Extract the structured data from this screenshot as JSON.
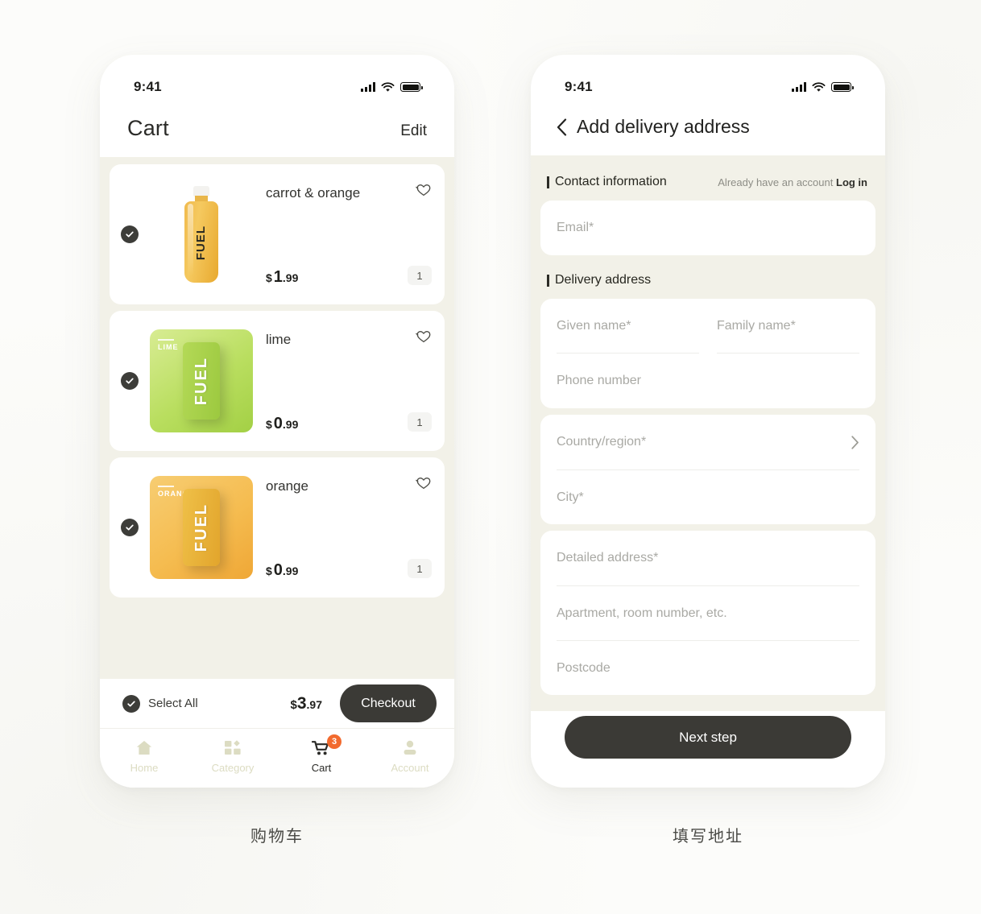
{
  "canvas": {
    "background": "#fcfcfa"
  },
  "phones": {
    "left_caption": "购物车",
    "right_caption": "填写地址"
  },
  "statusbar": {
    "time": "9:41",
    "signal_icon": "signal-bars-icon",
    "wifi_icon": "wifi-icon",
    "battery_icon": "battery-full-icon"
  },
  "cart_screen": {
    "title": "Cart",
    "edit_label": "Edit",
    "currency": "$",
    "items": [
      {
        "name": "carrot & orange",
        "price_whole": "1",
        "price_cents": ".99",
        "quantity": "1",
        "selected": true,
        "image_kind": "bottle",
        "tile_label": "",
        "color_from": "#f0ba4d",
        "color_to": "#e8a92f",
        "favorite_icon": "heart-outline-icon"
      },
      {
        "name": "lime",
        "price_whole": "0",
        "price_cents": ".99",
        "quantity": "1",
        "selected": true,
        "image_kind": "can",
        "tile_label": "LIME",
        "color_from": "#cfe87f",
        "color_to": "#a7d34a",
        "favorite_icon": "heart-outline-icon"
      },
      {
        "name": "orange",
        "price_whole": "0",
        "price_cents": ".99",
        "quantity": "1",
        "selected": true,
        "image_kind": "can",
        "tile_label": "ORANGE",
        "color_from": "#f7c765",
        "color_to": "#f0a93b",
        "favorite_icon": "heart-outline-icon"
      }
    ],
    "footer": {
      "select_all_label": "Select All",
      "select_all_checked": true,
      "total_currency": "$",
      "total_whole": "3",
      "total_cents": ".97",
      "checkout_label": "Checkout"
    },
    "tabbar": {
      "items": [
        {
          "label": "Home",
          "icon": "home-icon",
          "active": false
        },
        {
          "label": "Category",
          "icon": "grid-icon",
          "active": false
        },
        {
          "label": "Cart",
          "icon": "cart-icon",
          "active": true,
          "badge": "3"
        },
        {
          "label": "Account",
          "icon": "person-icon",
          "active": false
        }
      ]
    },
    "colors": {
      "list_background": "#f2f1e8",
      "accent_dark": "#3b3a36",
      "badge": "#f26a2e",
      "tab_inactive": "#dcdcc2"
    }
  },
  "address_screen": {
    "back_icon": "chevron-left-icon",
    "title": "Add delivery address",
    "contact_section": {
      "heading": "Contact information",
      "note_text": "Already have an account",
      "login_label": "Log in",
      "email_placeholder": "Email*"
    },
    "delivery_section": {
      "heading": "Delivery address",
      "given_name_placeholder": "Given name*",
      "family_name_placeholder": "Family name*",
      "phone_placeholder": "Phone number",
      "country_placeholder": "Country/region*",
      "country_chevron_icon": "chevron-right-icon",
      "city_placeholder": "City*",
      "detailed_address_placeholder": "Detailed address*",
      "apartment_placeholder": "Apartment, room number, etc.",
      "postcode_placeholder": "Postcode"
    },
    "next_label": "Next step"
  }
}
